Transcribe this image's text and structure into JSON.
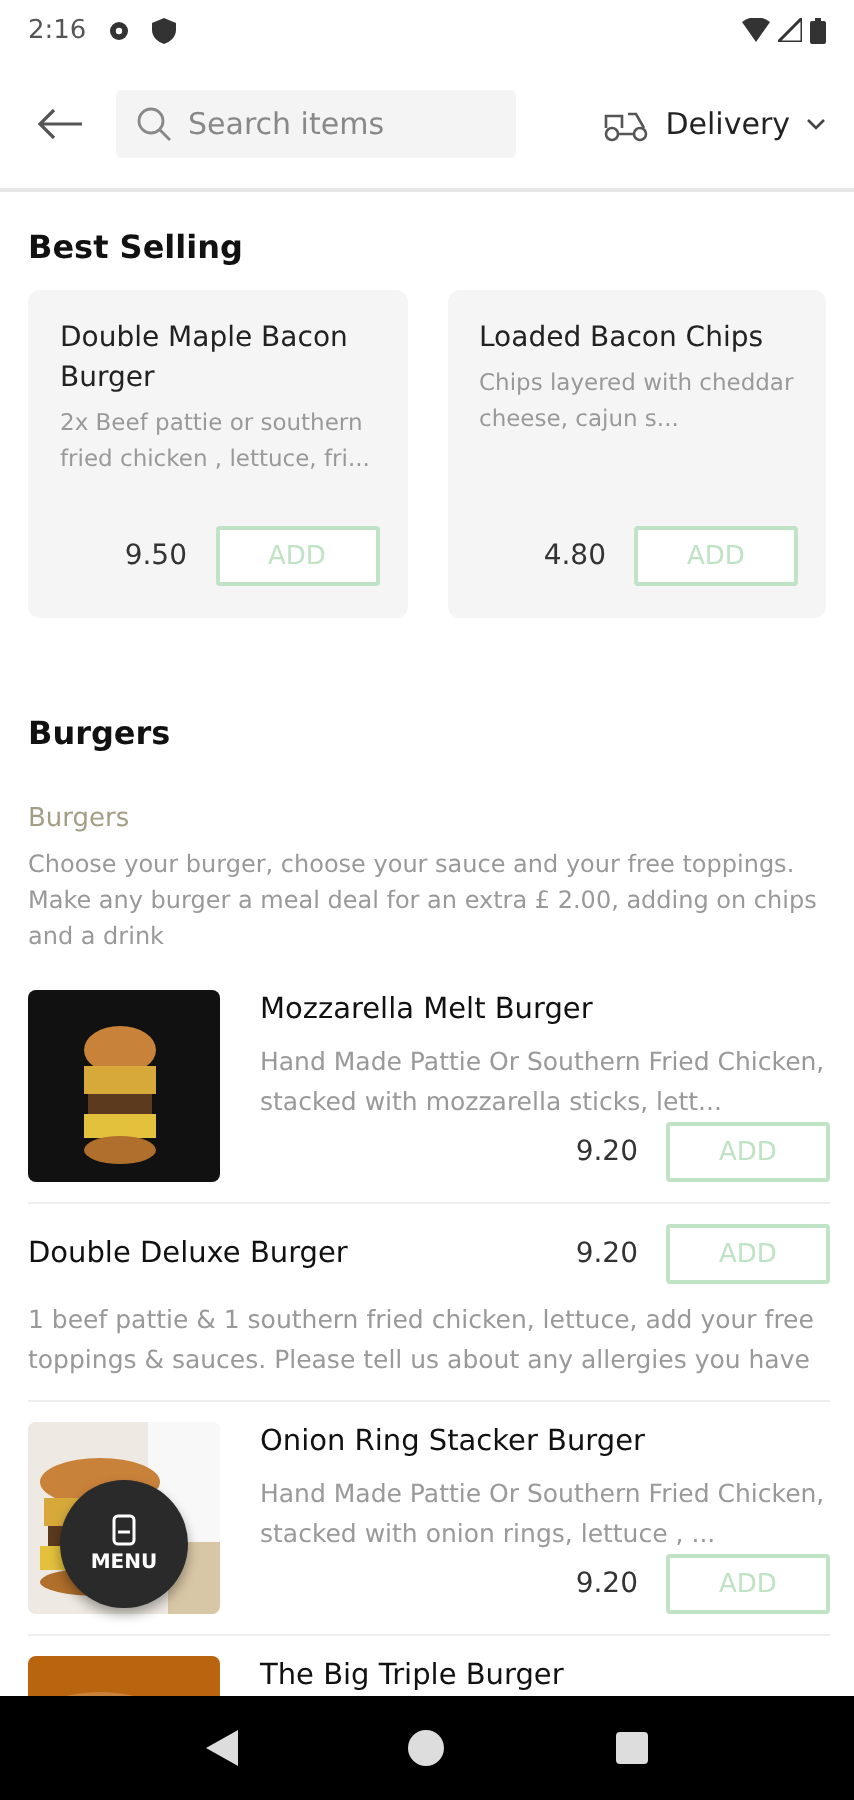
{
  "status_bar": {
    "time": "2:16"
  },
  "header": {
    "search": {
      "placeholder": "Search items"
    },
    "mode": "Delivery"
  },
  "best_selling": {
    "title": "Best Selling",
    "cards": [
      {
        "name": "Double Maple Bacon Burger",
        "description": "2x Beef pattie or southern fried chicken , lettuce, fri...",
        "price": "9.50",
        "button": "ADD"
      },
      {
        "name": "Loaded Bacon Chips",
        "description": "Chips layered with cheddar cheese, cajun  s...",
        "price": "4.80",
        "button": "ADD"
      }
    ]
  },
  "section": {
    "title": "Burgers",
    "category": "Burgers",
    "description": "Choose your burger, choose your sauce and your free toppings. Make any burger a meal deal for an extra £ 2.00, adding on chips and a drink",
    "items": [
      {
        "name": "Mozzarella Melt Burger",
        "description": "Hand Made Pattie Or Southern Fried Chicken, stacked with mozzarella sticks, lett...",
        "price": "9.20",
        "button": "ADD"
      },
      {
        "kind": "plain",
        "name": "Double Deluxe Burger",
        "description": "1 beef pattie & 1 southern fried chicken, lettuce, add your free toppings & sauces. Please tell us about any allergies you have",
        "price": "9.20",
        "button": "ADD"
      },
      {
        "name": "Onion Ring Stacker Burger",
        "description": "Hand Made Pattie Or Southern Fried Chicken, stacked with onion rings, lettuce , ...",
        "price": "9.20",
        "button": "ADD"
      },
      {
        "name": "The Big Triple Burger"
      }
    ]
  },
  "fab": {
    "label": "MENU"
  }
}
